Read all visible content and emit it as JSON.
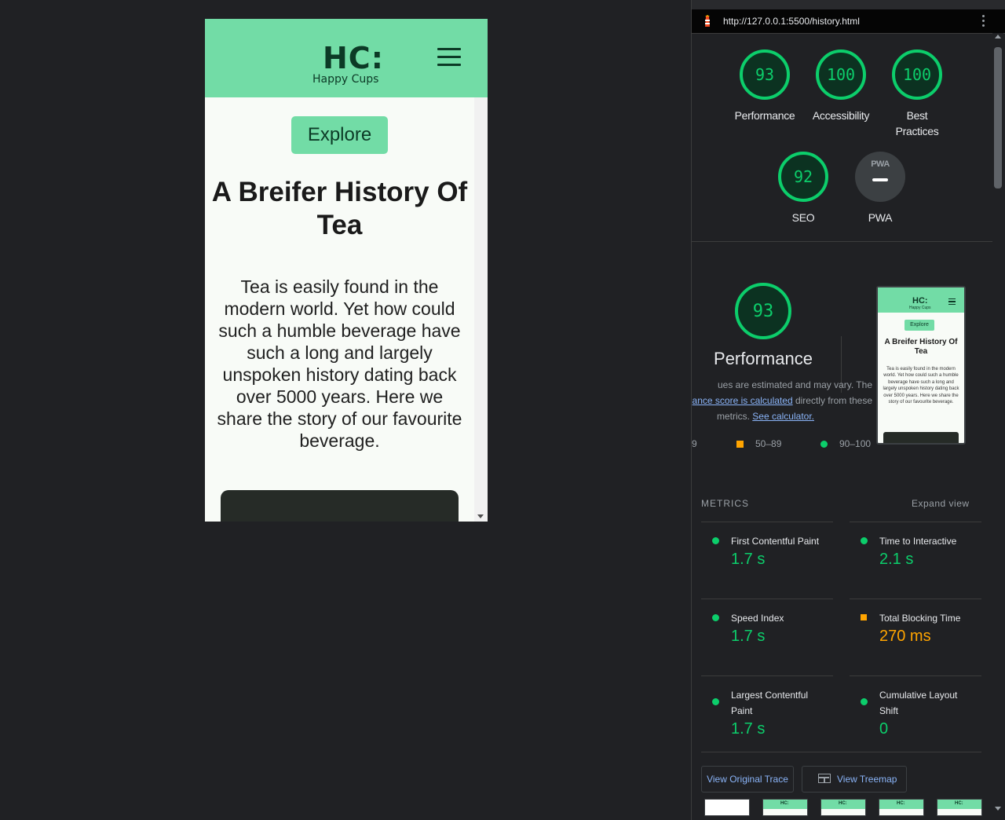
{
  "site": {
    "logo": "HC:",
    "tagline": "Happy Cups",
    "explore_label": "Explore",
    "heading": "A Breifer History Of Tea",
    "intro": "Tea is easily found in the modern world. Yet how could such a humble beverage have such a long and largely unspoken history dating back over 5000 years. Here we share the story of our favourite beverage."
  },
  "devtools": {
    "url": "http://127.0.0.1:5500/history.html"
  },
  "scores": [
    {
      "label": "Performance",
      "score": "93",
      "value": 93
    },
    {
      "label": "Accessibility",
      "score": "100",
      "value": 100
    },
    {
      "label": "Best Practices",
      "score": "100",
      "value": 100
    },
    {
      "label": "SEO",
      "score": "92",
      "value": 92
    },
    {
      "label": "PWA",
      "logo": "PWA"
    }
  ],
  "performance": {
    "score": "93",
    "title": "Performance",
    "desc_1": "ues are estimated and may vary. The",
    "desc_link_1": "ance score is calculated",
    "desc_2": " directly from these",
    "desc_3": "metrics. ",
    "desc_link_2": "See calculator.",
    "legend_fail": "9",
    "legend_average": "50–89",
    "legend_pass": "90–100"
  },
  "metrics": {
    "header": "METRICS",
    "expand_label": "Expand view",
    "items": [
      {
        "name": "First Contentful Paint",
        "value": "1.7 s",
        "rating": "pass"
      },
      {
        "name": "Time to Interactive",
        "value": "2.1 s",
        "rating": "pass"
      },
      {
        "name": "Speed Index",
        "value": "1.7 s",
        "rating": "pass"
      },
      {
        "name": "Total Blocking Time",
        "value": "270 ms",
        "rating": "average"
      },
      {
        "name": "Largest Contentful Paint",
        "value": "1.7 s",
        "rating": "pass"
      },
      {
        "name": "Cumulative Layout Shift",
        "value": "0",
        "rating": "pass"
      }
    ]
  },
  "buttons": {
    "view_trace": "View Original Trace",
    "view_treemap": "View Treemap"
  },
  "colors": {
    "pass": "#0cce6b",
    "average": "#ffa400",
    "brand": "#72dca6",
    "brand_dark": "#0c3a26"
  }
}
